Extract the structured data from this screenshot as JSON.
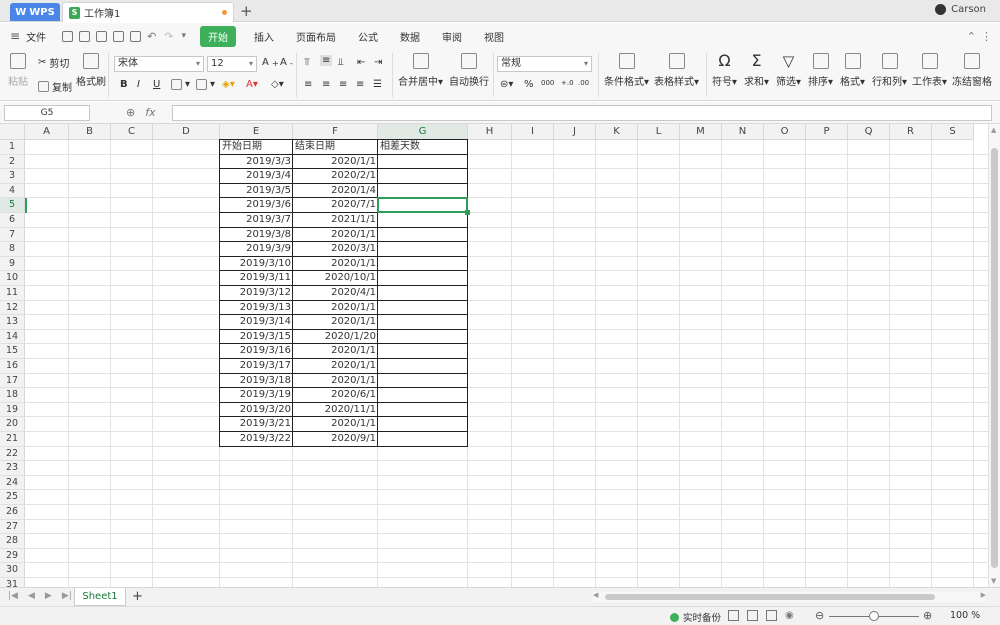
{
  "titlebar": {
    "wps_label": "WPS",
    "tab_title": "工作簿1",
    "add_tab": "+",
    "user": "Carson"
  },
  "menubar": {
    "file": "文件",
    "items": [
      "开始",
      "插入",
      "页面布局",
      "公式",
      "数据",
      "审阅",
      "视图"
    ]
  },
  "ribbon": {
    "paste": "粘贴",
    "cut": "剪切",
    "copy": "复制",
    "format_painter": "格式刷",
    "font_name": "宋体",
    "font_size": "12",
    "bold": "B",
    "italic": "I",
    "underline": "U",
    "merge": "合并居中",
    "wrap": "自动换行",
    "number_format": "常规",
    "percent": "%",
    "thousands": "000",
    "cond_format": "条件格式",
    "table_style": "表格样式",
    "symbol": "符号",
    "sum": "求和",
    "filter": "筛选",
    "sort": "排序",
    "format": "格式",
    "rowcol": "行和列",
    "worksheet": "工作表",
    "freeze": "冻结窗格"
  },
  "formula_bar": {
    "name_box": "G5",
    "formula": ""
  },
  "grid": {
    "columns": [
      "A",
      "B",
      "C",
      "D",
      "E",
      "F",
      "G",
      "H",
      "I",
      "J",
      "K",
      "L",
      "M",
      "N",
      "O",
      "P",
      "Q",
      "R",
      "S"
    ],
    "active_column": "G",
    "active_row": 5,
    "row_numbers": [
      "1",
      "2",
      "3",
      "4",
      "5",
      "6",
      "7",
      "8",
      "9",
      "10",
      "11",
      "12",
      "13",
      "14",
      "15",
      "16",
      "17",
      "18",
      "19",
      "20",
      "21",
      "22",
      "23",
      "24",
      "25",
      "26",
      "27",
      "28",
      "29",
      "30",
      "31"
    ],
    "headers": [
      "开始日期",
      "结束日期",
      "相差天数"
    ],
    "rows": [
      [
        "2019/3/3",
        "2020/1/1"
      ],
      [
        "2019/3/4",
        "2020/2/1"
      ],
      [
        "2019/3/5",
        "2020/1/4"
      ],
      [
        "2019/3/6",
        "2020/7/1"
      ],
      [
        "2019/3/7",
        "2021/1/1"
      ],
      [
        "2019/3/8",
        "2020/1/1"
      ],
      [
        "2019/3/9",
        "2020/3/1"
      ],
      [
        "2019/3/10",
        "2020/1/1"
      ],
      [
        "2019/3/11",
        "2020/10/1"
      ],
      [
        "2019/3/12",
        "2020/4/1"
      ],
      [
        "2019/3/13",
        "2020/1/1"
      ],
      [
        "2019/3/14",
        "2020/1/1"
      ],
      [
        "2019/3/15",
        "2020/1/20"
      ],
      [
        "2019/3/16",
        "2020/1/1"
      ],
      [
        "2019/3/17",
        "2020/1/1"
      ],
      [
        "2019/3/18",
        "2020/1/1"
      ],
      [
        "2019/3/19",
        "2020/6/1"
      ],
      [
        "2019/3/20",
        "2020/11/1"
      ],
      [
        "2019/3/21",
        "2020/1/1"
      ],
      [
        "2019/3/22",
        "2020/9/1"
      ]
    ]
  },
  "sheets": {
    "tabs": [
      "Sheet1"
    ],
    "add": "+"
  },
  "status": {
    "backup": "实时备份",
    "zoom": "100 %"
  },
  "colors": {
    "accent": "#3eb05b",
    "wps_blue": "#4a86e8",
    "selection": "#2f9e5a"
  }
}
